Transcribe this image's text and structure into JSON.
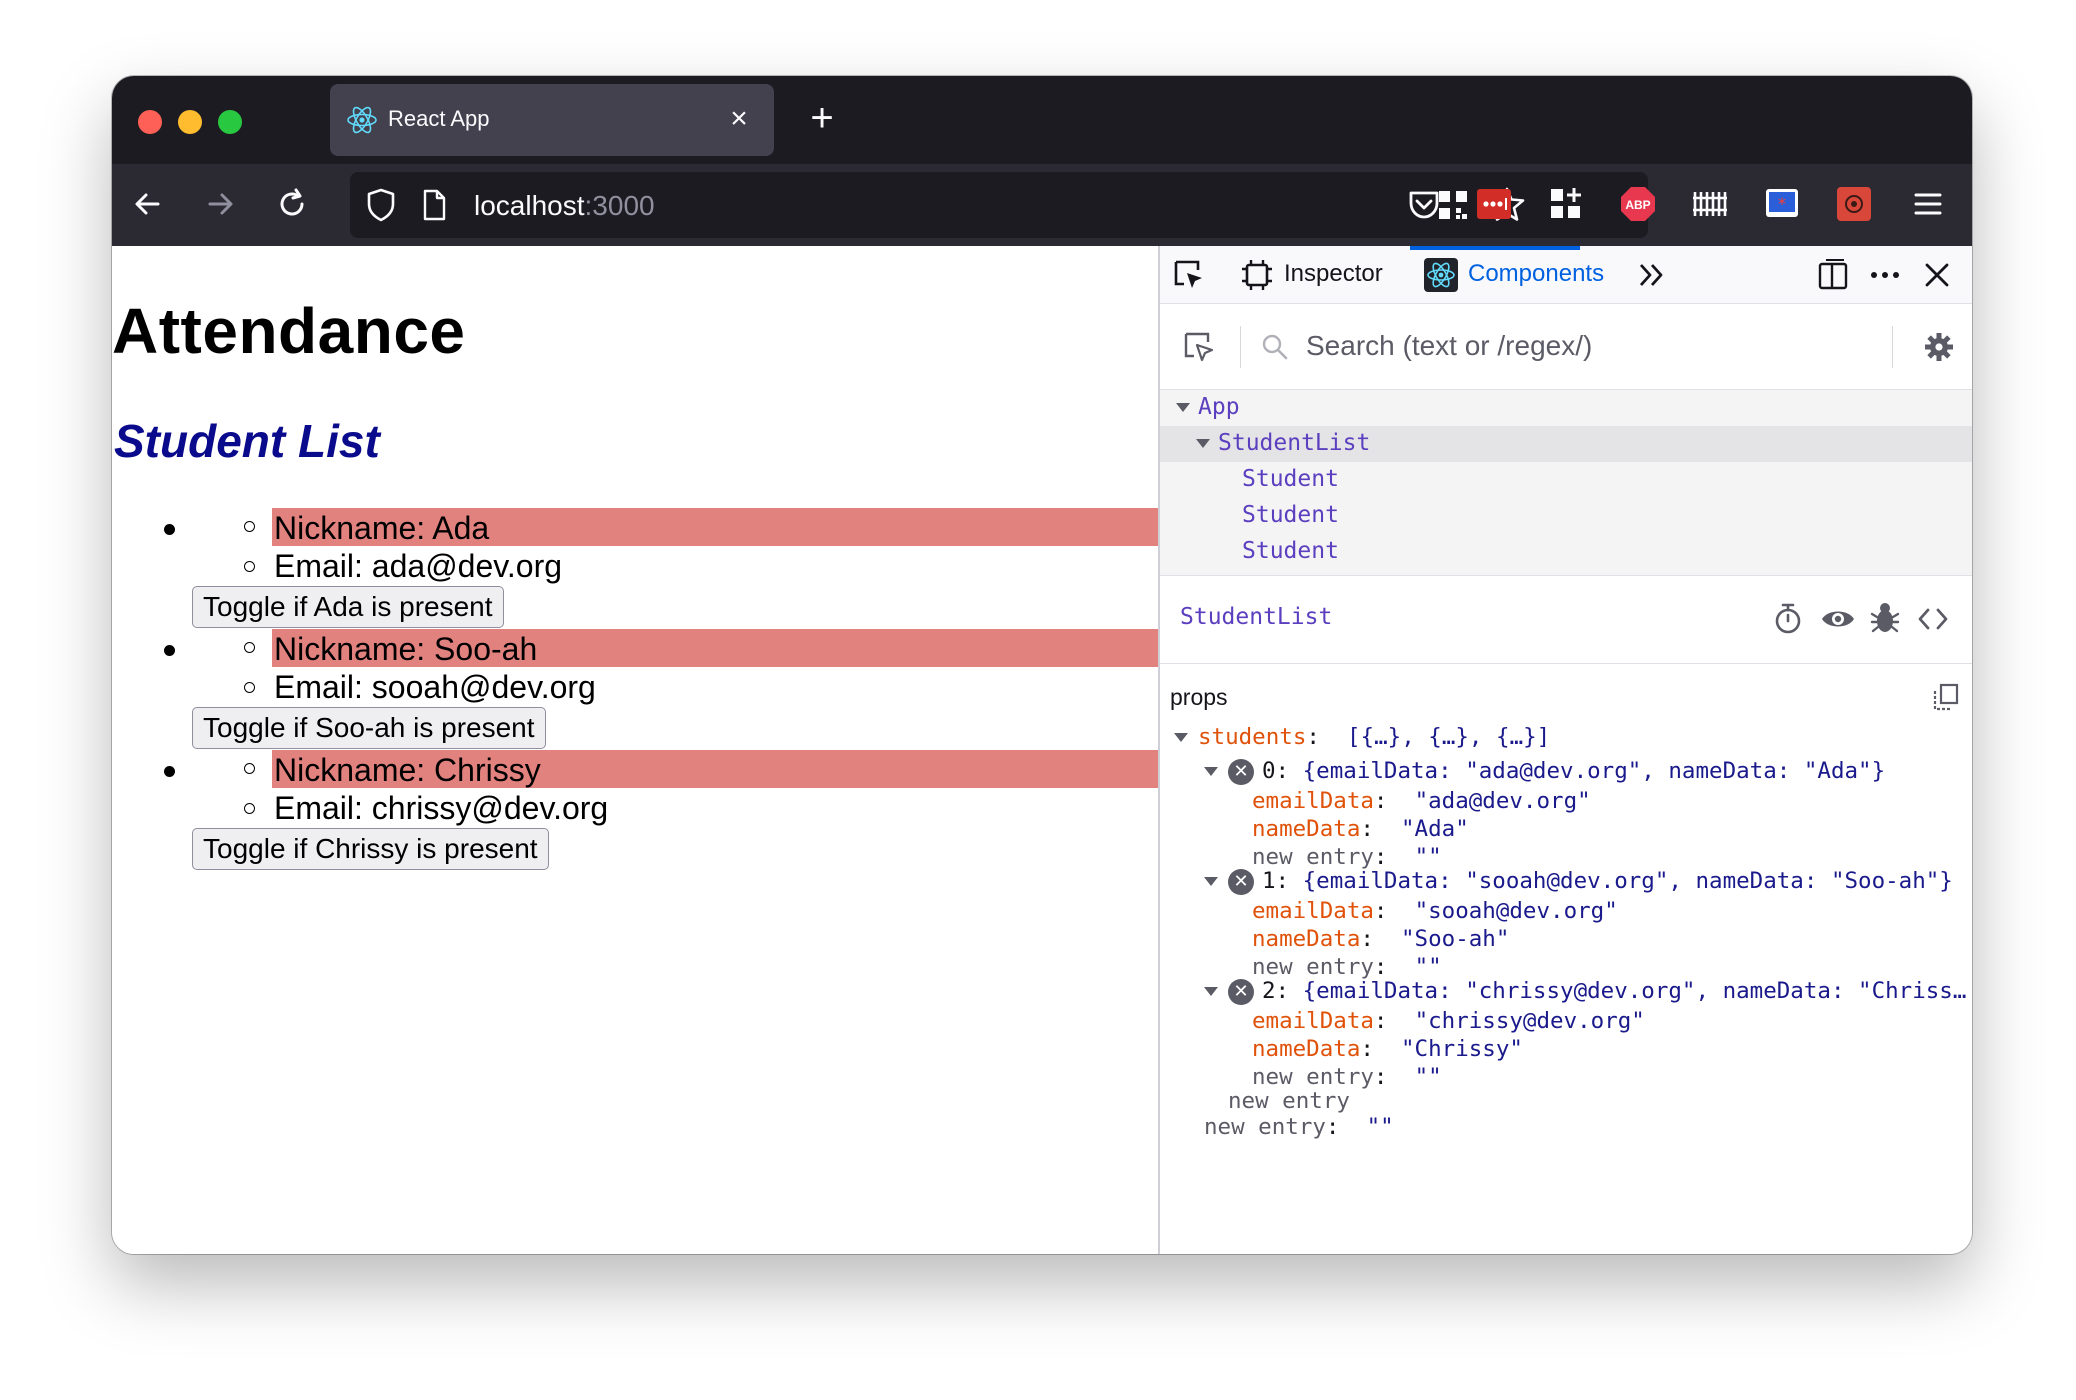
{
  "browser": {
    "tab_title": "React App",
    "tab_close": "×",
    "new_tab": "+",
    "url_host": "localhost",
    "url_port": ":3000"
  },
  "page": {
    "title": "Attendance",
    "subtitle": "Student List",
    "students": [
      {
        "nickname": "Nickname: Ada",
        "email": "Email: ada@dev.org",
        "toggle": "Toggle if Ada is present"
      },
      {
        "nickname": "Nickname: Soo-ah",
        "email": "Email: sooah@dev.org",
        "toggle": "Toggle if Soo-ah is present"
      },
      {
        "nickname": "Nickname: Chrissy",
        "email": "Email: chrissy@dev.org",
        "toggle": "Toggle if Chrissy is present"
      }
    ],
    "highlight_color": "#e2827f"
  },
  "devtools": {
    "tabs": {
      "inspector": "Inspector",
      "components": "Components"
    },
    "search_placeholder": "Search (text or /regex/)",
    "tree": {
      "app": "App",
      "student_list": "StudentList",
      "student": "Student"
    },
    "selected_component": "StudentList",
    "props_title": "props",
    "students_key": "students",
    "students_summary": "[{…}, {…}, {…}]",
    "entries": [
      {
        "index": "0:",
        "summary": "{emailData: \"ada@dev.org\", nameData: \"Ada\"}",
        "email": "\"ada@dev.org\"",
        "name": "\"Ada\""
      },
      {
        "index": "1:",
        "summary": "{emailData: \"sooah@dev.org\", nameData: \"Soo-ah\"}",
        "email": "\"sooah@dev.org\"",
        "name": "\"Soo-ah\""
      },
      {
        "index": "2:",
        "summary": "{emailData: \"chrissy@dev.org\", nameData: \"Chriss…",
        "email": "\"chrissy@dev.org\"",
        "name": "\"Chrissy\""
      }
    ],
    "email_key": "emailData",
    "name_key": "nameData",
    "new_entry_key": "new entry",
    "empty_value": "\"\"",
    "colon": ":",
    "accent": "#0061e0"
  }
}
